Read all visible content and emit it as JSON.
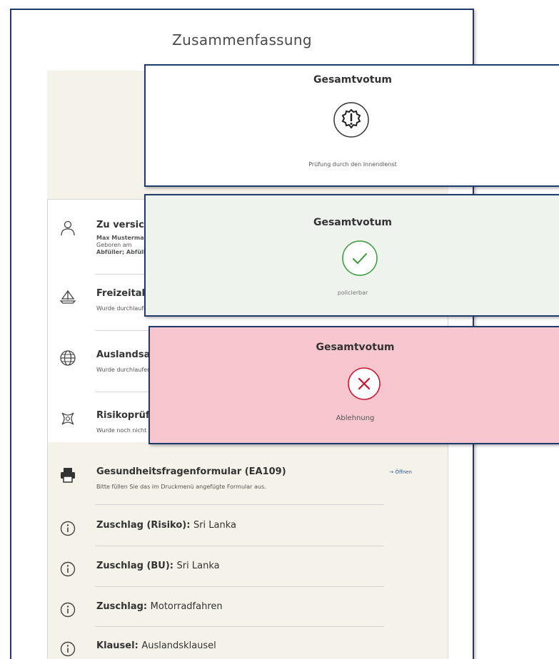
{
  "summary": {
    "title": "Zusammenfassung",
    "items": [
      {
        "title": "Zu versicherte Person",
        "lines": [
          "Max Mustermann",
          "Geboren am",
          "Abfüller; Abfüllerin"
        ]
      },
      {
        "title": "Freizeitaktivitäten",
        "sub": "Wurde durchlaufen - Entnehmen Sie die Eingabe bitte dem Antrag"
      },
      {
        "title": "Auslandsaufenthalte",
        "sub": "Wurde durchlaufen"
      },
      {
        "title": "Risikoprüfung",
        "sub": "Wurde noch nicht durchlaufen"
      },
      {
        "title": "Gesundheitsfragenformular (EA109)",
        "sub": "Bitte füllen Sie das im Druckmenü angefügte Formular aus.",
        "link": "→ Öffnen"
      },
      {
        "label": "Zuschlag (Risiko):",
        "value": "Sri Lanka"
      },
      {
        "label": "Zuschlag (BU):",
        "value": "Sri Lanka"
      },
      {
        "label": "Zuschlag:",
        "value": "Motorradfahren"
      },
      {
        "label": "Klausel:",
        "value": "Auslandsklausel"
      }
    ]
  },
  "cards": [
    {
      "title": "Gesamtvotum",
      "status": "Prüfung durch den Innendienst",
      "icon": "warning-badge-icon",
      "bg": "#ffffff"
    },
    {
      "title": "Gesamtvotum",
      "status": "policierbar",
      "icon": "check-circle-icon",
      "bg": "#eef4ed",
      "accent": "#3a9a3a"
    },
    {
      "title": "Gesamtvotum",
      "status": "Ablehnung",
      "icon": "x-circle-icon",
      "bg": "#f7c6cf",
      "accent": "#d0112b"
    }
  ],
  "colors": {
    "frame": "#1f3b6c",
    "beige": "#f5f2e9",
    "link": "#2d5aa8"
  }
}
